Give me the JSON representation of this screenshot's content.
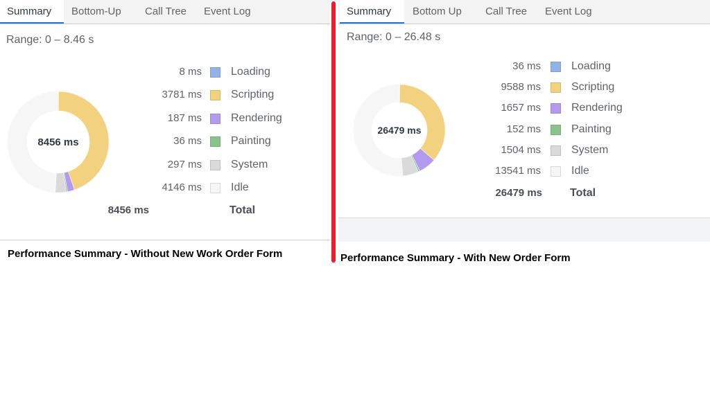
{
  "colors": {
    "loading": "#8fb3e8",
    "scripting": "#f2d27e",
    "rendering": "#b19af0",
    "painting": "#8bc48a",
    "system": "#dadada",
    "idle": "#f6f6f6",
    "divider": "#e8202a"
  },
  "left": {
    "tabs": [
      "Summary",
      "Bottom-Up",
      "Call Tree",
      "Event Log"
    ],
    "active_tab": "Summary",
    "range": "Range: 0 – 8.46 s",
    "donut_center": "8456 ms",
    "legend": [
      {
        "value": "8 ms",
        "label": "Loading",
        "ms": 8,
        "color_key": "loading"
      },
      {
        "value": "3781 ms",
        "label": "Scripting",
        "ms": 3781,
        "color_key": "scripting"
      },
      {
        "value": "187 ms",
        "label": "Rendering",
        "ms": 187,
        "color_key": "rendering"
      },
      {
        "value": "36 ms",
        "label": "Painting",
        "ms": 36,
        "color_key": "painting"
      },
      {
        "value": "297 ms",
        "label": "System",
        "ms": 297,
        "color_key": "system"
      },
      {
        "value": "4146 ms",
        "label": "Idle",
        "ms": 4146,
        "color_key": "idle"
      }
    ],
    "total": {
      "value": "8456 ms",
      "label": "Total"
    },
    "caption": "Performance Summary - Without New Work Order Form"
  },
  "right": {
    "tabs": [
      "Summary",
      "Bottom Up",
      "Call Tree",
      "Event Log"
    ],
    "active_tab": "Summary",
    "range": "Range: 0 – 26.48 s",
    "donut_center": "26479 ms",
    "legend": [
      {
        "value": "36 ms",
        "label": "Loading",
        "ms": 36,
        "color_key": "loading"
      },
      {
        "value": "9588 ms",
        "label": "Scripting",
        "ms": 9588,
        "color_key": "scripting"
      },
      {
        "value": "1657 ms",
        "label": "Rendering",
        "ms": 1657,
        "color_key": "rendering"
      },
      {
        "value": "152 ms",
        "label": "Painting",
        "ms": 152,
        "color_key": "painting"
      },
      {
        "value": "1504 ms",
        "label": "System",
        "ms": 1504,
        "color_key": "system"
      },
      {
        "value": "13541 ms",
        "label": "Idle",
        "ms": 13541,
        "color_key": "idle"
      }
    ],
    "total": {
      "value": "26479 ms",
      "label": "Total"
    },
    "caption": "Performance Summary - With New Order Form"
  }
}
